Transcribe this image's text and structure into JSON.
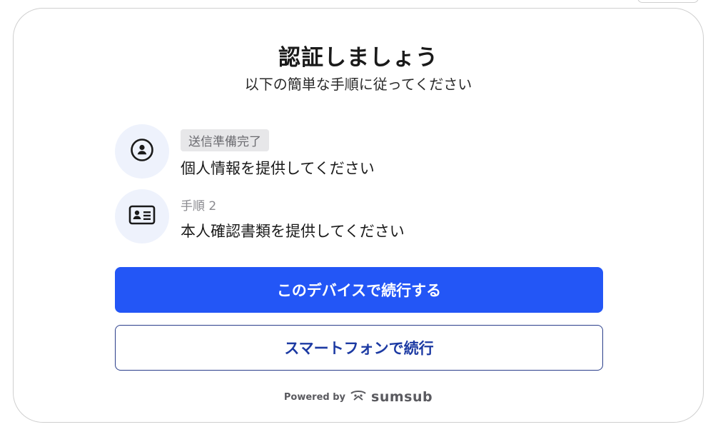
{
  "header": {
    "title": "認証しましょう",
    "subtitle": "以下の簡単な手順に従ってください"
  },
  "steps": [
    {
      "icon": "user-circle-icon",
      "status_badge": "送信準備完了",
      "text": "個人情報を提供してください"
    },
    {
      "icon": "id-card-icon",
      "label": "手順 2",
      "text": "本人確認書類を提供してください"
    }
  ],
  "buttons": {
    "continue_device": "このデバイスで続行する",
    "continue_phone": "スマートフォンで続行"
  },
  "footer": {
    "powered_by": "Powered by",
    "brand": "sumsub"
  },
  "colors": {
    "primary": "#2356f6",
    "icon_bg": "#eef2fc",
    "badge_bg": "#e7e7e9"
  }
}
